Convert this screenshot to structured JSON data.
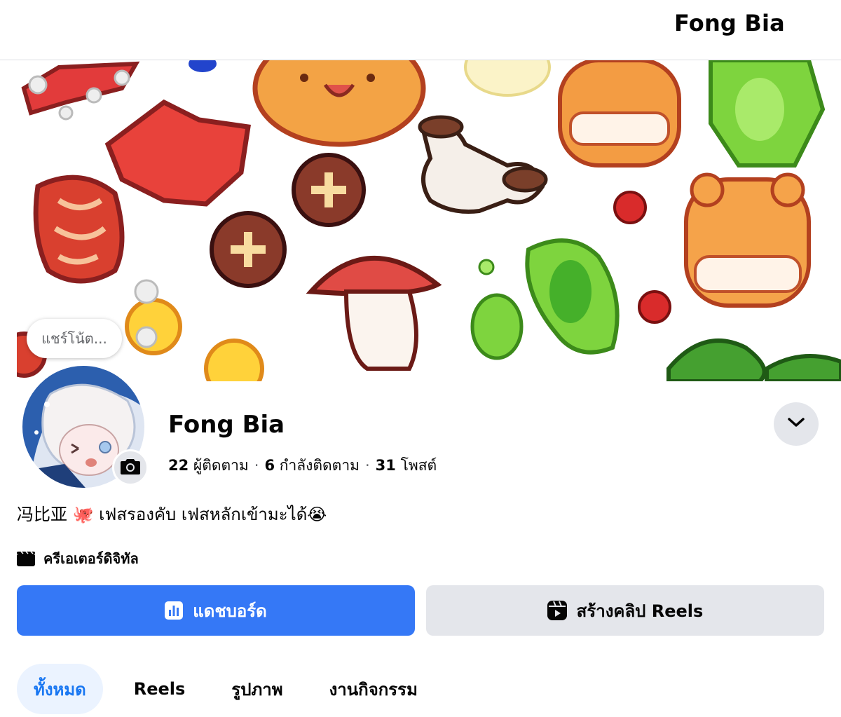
{
  "header": {
    "title": "Fong Bia"
  },
  "cover": {
    "note_bubble": "แชร์โน้ต..."
  },
  "profile": {
    "name": "Fong Bia",
    "followers_count": "22",
    "followers_label": "ผู้ติดตาม",
    "following_count": "6",
    "following_label": "กำลังติดตาม",
    "posts_count": "31",
    "posts_label": "โพสต์",
    "bio": "冯比亚 🐙 เฟสรองคับ เฟสหลักเข้ามะได้😭",
    "category": "ครีเอเตอร์ดิจิทัล"
  },
  "actions": {
    "dashboard_label": "แดชบอร์ด",
    "create_reel_label": "สร้างคลิป Reels"
  },
  "tabs": [
    {
      "label": "ทั้งหมด",
      "active": true
    },
    {
      "label": "Reels",
      "active": false
    },
    {
      "label": "รูปภาพ",
      "active": false
    },
    {
      "label": "งานกิจกรรม",
      "active": false
    }
  ],
  "icons": {
    "camera": "camera-icon",
    "chevron": "chevron-down-icon",
    "category": "clapperboard-icon",
    "dashboard": "bar-chart-icon",
    "reels": "reels-icon"
  },
  "colors": {
    "primary": "#3578f6",
    "secondary_bg": "#e4e6eb",
    "active_tab_bg": "#ebf3ff",
    "active_tab_text": "#1977f2"
  }
}
